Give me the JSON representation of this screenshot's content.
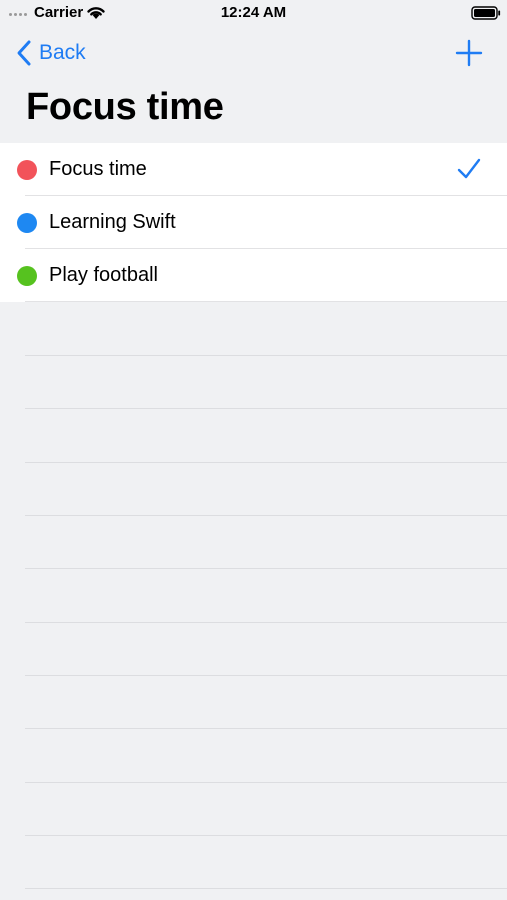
{
  "status_bar": {
    "carrier": "Carrier",
    "time": "12:24 AM"
  },
  "nav": {
    "back_label": "Back",
    "title": "Focus time",
    "add_icon": "plus-icon",
    "back_icon": "chevron-left-icon"
  },
  "colors": {
    "accent": "#1f7cf3",
    "background": "#f0f1f3"
  },
  "list": {
    "items": [
      {
        "label": "Focus time",
        "color": "#f2535a",
        "selected": true
      },
      {
        "label": "Learning Swift",
        "color": "#1e88f2",
        "selected": false
      },
      {
        "label": "Play football",
        "color": "#56c21f",
        "selected": false
      }
    ]
  }
}
